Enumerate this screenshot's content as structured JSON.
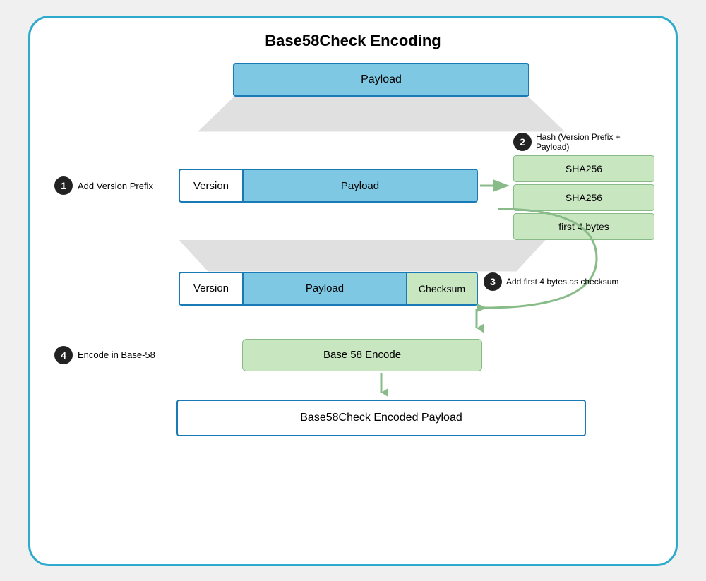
{
  "title": "Base58Check Encoding",
  "step1": {
    "circle": "1",
    "label": "Add Version Prefix"
  },
  "step2": {
    "circle": "2",
    "label": "Hash (Version Prefix + Payload)"
  },
  "step3": {
    "circle": "3",
    "label": "Add first 4 bytes as checksum"
  },
  "step4": {
    "circle": "4",
    "label": "Encode in Base-58"
  },
  "boxes": {
    "payload": "Payload",
    "version": "Version",
    "checksum": "Checksum",
    "sha256_1": "SHA256",
    "sha256_2": "SHA256",
    "first4bytes": "first 4 bytes",
    "base58encode": "Base 58 Encode",
    "finalOutput": "Base58Check Encoded Payload"
  }
}
